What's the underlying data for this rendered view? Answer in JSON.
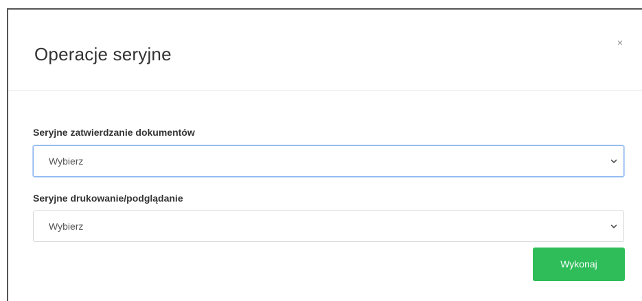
{
  "modal": {
    "title": "Operacje seryjne",
    "close_label": "×"
  },
  "form": {
    "batch_approval": {
      "label": "Seryjne zatwierdzanie dokumentów",
      "selected": "Wybierz"
    },
    "batch_print": {
      "label": "Seryjne drukowanie/podglądanie",
      "selected": "Wybierz"
    },
    "submit_label": "Wykonaj"
  },
  "colors": {
    "accent": "#2ebd59",
    "focus": "#8ab4ef"
  },
  "icons": {
    "close": "close-icon",
    "dropdown": "chevron-down-icon"
  }
}
